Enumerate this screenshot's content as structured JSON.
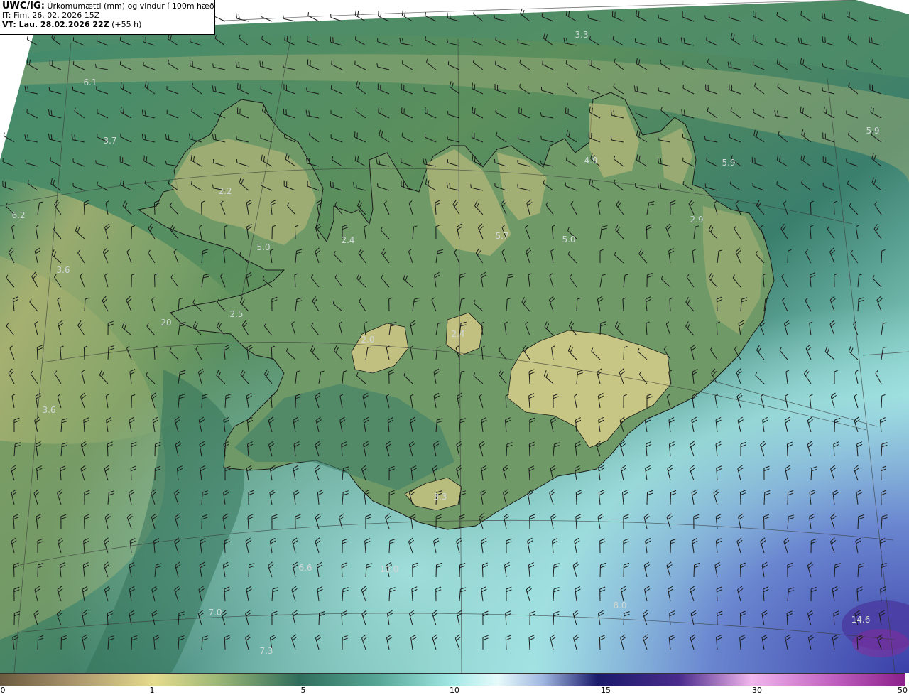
{
  "header": {
    "title_bold": "UWC/IG:",
    "title_rest": "Úrkomumætti (mm) og vindur í 100m hæð",
    "init_time": "IT: Fim. 26. 02. 2026 15Z",
    "valid_bold": "VT: Lau. 28.02.2026 22Z",
    "valid_lead": "(+55 h)"
  },
  "colorbar": {
    "ticks": [
      "0",
      "1",
      "5",
      "10",
      "15",
      "30",
      "50"
    ],
    "colors": [
      "#6b5a3f",
      "#a89a63",
      "#e3d98a",
      "#2f6d5b",
      "#9ee8e8",
      "#ffffff",
      "#2b2b8c",
      "#1a1a6a",
      "#e6a8e0",
      "#8a1f8a"
    ]
  },
  "map_values": [
    {
      "text": "3.3"
    },
    {
      "text": "6.1"
    },
    {
      "text": "3.7"
    },
    {
      "text": "5.9"
    },
    {
      "text": "4.9"
    },
    {
      "text": "5.9"
    },
    {
      "text": "2.2"
    },
    {
      "text": "6.2"
    },
    {
      "text": "2.9"
    },
    {
      "text": "5.7"
    },
    {
      "text": "5.0"
    },
    {
      "text": "2.4"
    },
    {
      "text": "5.0"
    },
    {
      "text": "3.6"
    },
    {
      "text": "2.5"
    },
    {
      "text": "20"
    },
    {
      "text": "2.0"
    },
    {
      "text": "2.4"
    },
    {
      "text": "3.6"
    },
    {
      "text": "3.3"
    },
    {
      "text": "6.6"
    },
    {
      "text": "10.0"
    },
    {
      "text": "7.0"
    },
    {
      "text": "8.0"
    },
    {
      "text": "14.6"
    },
    {
      "text": "7.3"
    }
  ]
}
